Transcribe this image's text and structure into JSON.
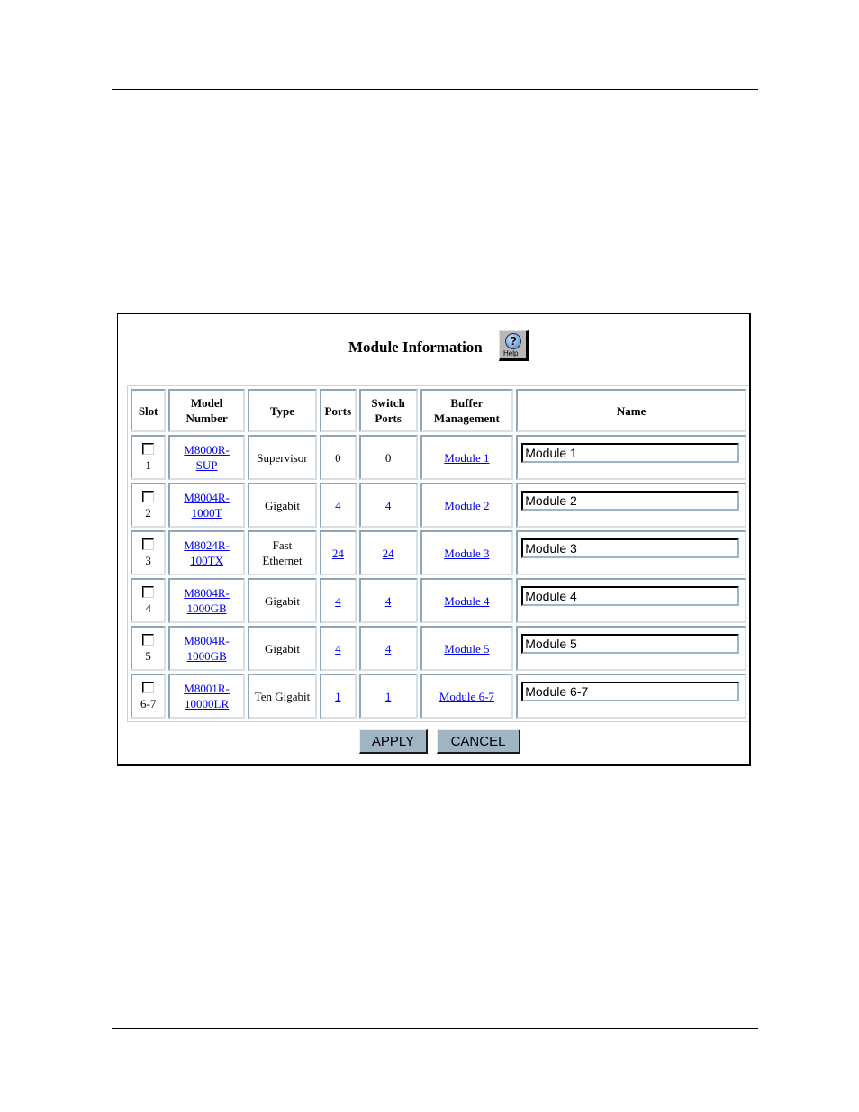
{
  "panel": {
    "title": "Module Information",
    "help_icon_label": "Help",
    "help_icon_glyph": "?"
  },
  "table": {
    "headers": {
      "slot": "Slot",
      "model_line1": "Model",
      "model_line2": "Number",
      "type": "Type",
      "ports": "Ports",
      "switch_line1": "Switch",
      "switch_line2": "Ports",
      "buffer_line1": "Buffer",
      "buffer_line2": "Management",
      "name": "Name"
    },
    "rows": [
      {
        "slot": "1",
        "checked": false,
        "model_line1": "M8000R-",
        "model_line2": "SUP",
        "type_line1": "Supervisor",
        "type_line2": "",
        "ports": "0",
        "ports_link": false,
        "switch_ports": "0",
        "switch_link": false,
        "buffer": "Module 1",
        "name_value": "Module 1"
      },
      {
        "slot": "2",
        "checked": false,
        "model_line1": "M8004R-",
        "model_line2": "1000T",
        "type_line1": "Gigabit",
        "type_line2": "",
        "ports": "4",
        "ports_link": true,
        "switch_ports": "4",
        "switch_link": true,
        "buffer": "Module 2",
        "name_value": "Module 2"
      },
      {
        "slot": "3",
        "checked": false,
        "model_line1": "M8024R-",
        "model_line2": "100TX",
        "type_line1": "Fast",
        "type_line2": "Ethernet",
        "ports": "24",
        "ports_link": true,
        "switch_ports": "24",
        "switch_link": true,
        "buffer": "Module 3",
        "name_value": "Module 3"
      },
      {
        "slot": "4",
        "checked": false,
        "model_line1": "M8004R-",
        "model_line2": "1000GB",
        "type_line1": "Gigabit",
        "type_line2": "",
        "ports": "4",
        "ports_link": true,
        "switch_ports": "4",
        "switch_link": true,
        "buffer": "Module 4",
        "name_value": "Module 4"
      },
      {
        "slot": "5",
        "checked": false,
        "model_line1": "M8004R-",
        "model_line2": "1000GB",
        "type_line1": "Gigabit",
        "type_line2": "",
        "ports": "4",
        "ports_link": true,
        "switch_ports": "4",
        "switch_link": true,
        "buffer": "Module 5",
        "name_value": "Module 5"
      },
      {
        "slot": "6-7",
        "checked": false,
        "model_line1": "M8001R-",
        "model_line2": "10000LR",
        "type_line1": "Ten Gigabit",
        "type_line2": "",
        "ports": "1",
        "ports_link": true,
        "switch_ports": "1",
        "switch_link": true,
        "buffer": "Module 6-7",
        "name_value": "Module 6-7"
      }
    ]
  },
  "buttons": {
    "apply": "APPLY",
    "cancel": "CANCEL"
  },
  "colors": {
    "link": "#0000ee",
    "button_bg": "#9fb5c3",
    "cell_border": "#9fb4c2"
  }
}
